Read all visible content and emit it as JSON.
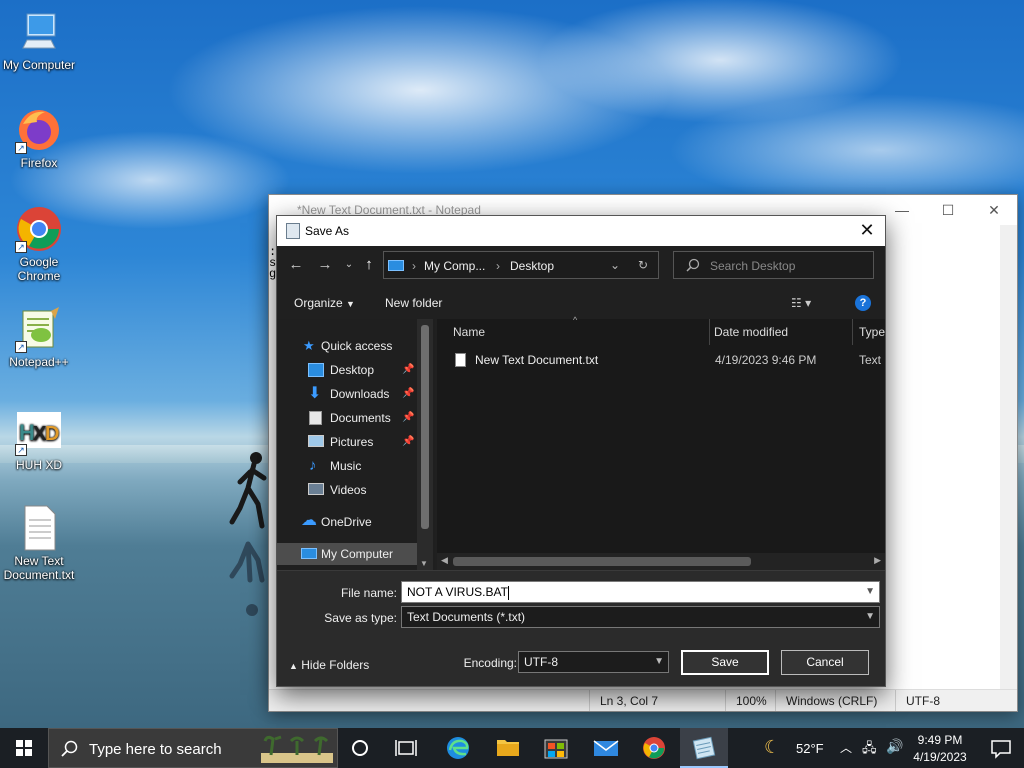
{
  "desktop": {
    "icons": [
      {
        "label": "My Computer",
        "icon": "computer-icon"
      },
      {
        "label": "Firefox",
        "icon": "firefox-icon"
      },
      {
        "label": "Google Chrome",
        "icon": "chrome-icon"
      },
      {
        "label": "Notepad++",
        "icon": "notepadpp-icon"
      },
      {
        "label": "HUH XD",
        "icon": "huh-xd-icon"
      },
      {
        "label": "New Text Document.txt",
        "icon": "text-file-icon"
      }
    ]
  },
  "notepad": {
    "title": "*New Text Document.txt - Notepad",
    "text_lines": [
      ":",
      "s",
      "g"
    ],
    "status": {
      "position": "Ln 3, Col 7",
      "zoom": "100%",
      "line_endings": "Windows (CRLF)",
      "encoding": "UTF-8"
    }
  },
  "save_dialog": {
    "title": "Save As",
    "address": {
      "segments": [
        "My Comp...",
        "Desktop"
      ]
    },
    "search_placeholder": "Search Desktop",
    "commands": {
      "organize": "Organize",
      "new_folder": "New folder"
    },
    "nav": {
      "quick_access": "Quick access",
      "items": [
        {
          "label": "Desktop",
          "pinned": true
        },
        {
          "label": "Downloads",
          "pinned": true
        },
        {
          "label": "Documents",
          "pinned": true
        },
        {
          "label": "Pictures",
          "pinned": true
        },
        {
          "label": "Music",
          "pinned": false
        },
        {
          "label": "Videos",
          "pinned": false
        }
      ],
      "onedrive": "OneDrive",
      "my_computer": "My Computer"
    },
    "columns": {
      "name": "Name",
      "date": "Date modified",
      "type": "Type"
    },
    "files": [
      {
        "name": "New Text Document.txt",
        "date": "4/19/2023 9:46 PM",
        "type": "Text D"
      }
    ],
    "file_name_label": "File name:",
    "file_name_value": "NOT A VIRUS.BAT",
    "save_type_label": "Save as type:",
    "save_type_value": "Text Documents (*.txt)",
    "hide_folders": "Hide Folders",
    "encoding_label": "Encoding:",
    "encoding_value": "UTF-8",
    "save_button": "Save",
    "cancel_button": "Cancel"
  },
  "taskbar": {
    "search_placeholder": "Type here to search",
    "weather": "52°F",
    "time": "9:49 PM",
    "date": "4/19/2023"
  }
}
